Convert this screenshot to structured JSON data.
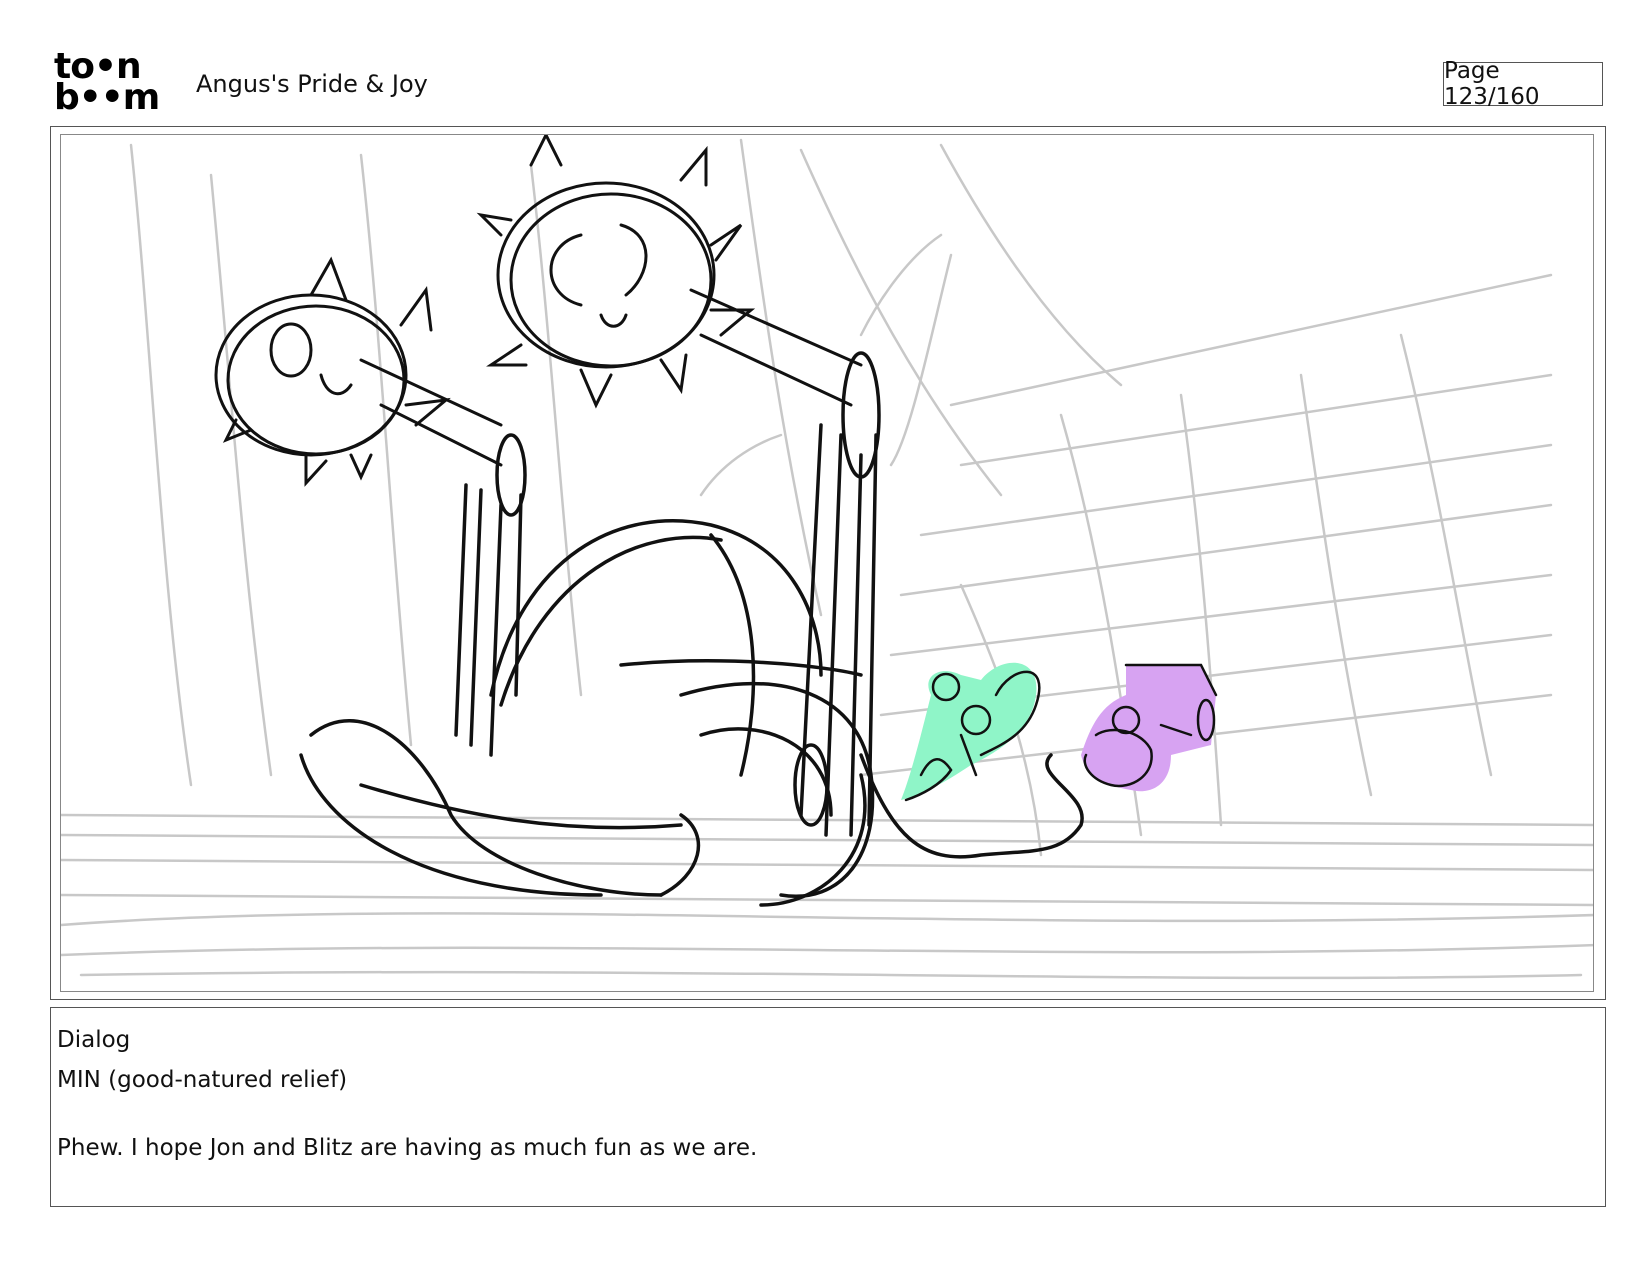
{
  "header": {
    "logo_line1": "to•n",
    "logo_line2": "b••m",
    "project_title": "Angus's Pride & Joy",
    "page_label": "Page 123/160"
  },
  "panel": {
    "character_colors": {
      "green": "#8ff5c8",
      "purple": "#d7a3f2"
    }
  },
  "dialog": {
    "heading": "Dialog",
    "speaker": "MIN (good-natured relief)",
    "text": "Phew. I hope Jon and Blitz are having as much fun as we are."
  }
}
